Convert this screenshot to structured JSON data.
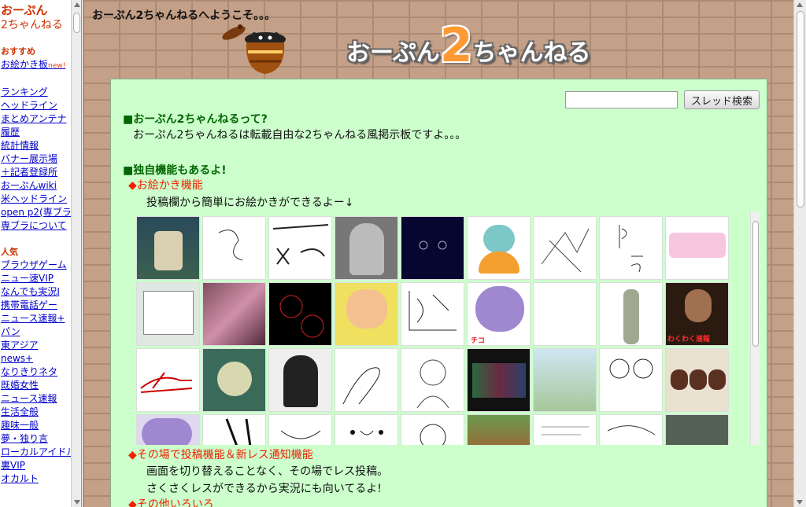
{
  "sidebar": {
    "brand_line1": "おーぷん",
    "brand_line2": "2ちゃんねる",
    "recommend_heading": "おすすめ",
    "oekaki_link": "お絵かき板",
    "new_badge": "new!",
    "links": [
      "ランキング",
      "ヘッドライン",
      "まとめアンテナ",
      "履歴",
      "統計情報",
      "バナー展示場",
      "＋記者登録所",
      "おーぷんwiki",
      "米ヘッドライン",
      "open p2(専ブラ)",
      "専ブラについて"
    ],
    "popular_heading": "人気",
    "popular_links": [
      "ブラウザゲーム",
      "ニュー速VIP",
      "なんでも実況J",
      "携帯電話ゲー",
      "ニュース速報+",
      "パン",
      "東アジア",
      "news+",
      "なりきりネタ",
      "既婚女性",
      "ニュース速報",
      "生活全般",
      "趣味一般",
      "夢・独り言",
      "ローカルアイドル",
      "裏VIP",
      "オカルト"
    ]
  },
  "main": {
    "welcome": "おーぷん2ちゃんねるへようこそ。。。",
    "logo": {
      "part1": "おーぷん",
      "digit": "2",
      "part2": "ちゃんねる"
    },
    "search": {
      "placeholder": "",
      "button": "スレッド検索"
    },
    "section1": {
      "heading": "■おーぷん2ちゃんねるって?",
      "body": "おーぷん2ちゃんねるは転載自由な2ちゃんねる風掲示板ですよ。。。"
    },
    "section2": {
      "heading": "■独自機能もあるよ!"
    },
    "feature1": {
      "title": "◆お絵かき機能",
      "body": "投稿欄から簡単にお絵かきができるよー↓"
    },
    "feature2": {
      "title": "◆その場で投稿機能＆新レス通知機能",
      "body1": "画面を切り替えることなく、その場でレス投稿。",
      "body2": "さくさくレスができるから実況にも向いてるよ!"
    },
    "feature3": {
      "title": "◆その他いろいろ"
    },
    "thumb_labels": {
      "t12_caption": "チコ",
      "t16_caption": "わくわく速報"
    }
  }
}
